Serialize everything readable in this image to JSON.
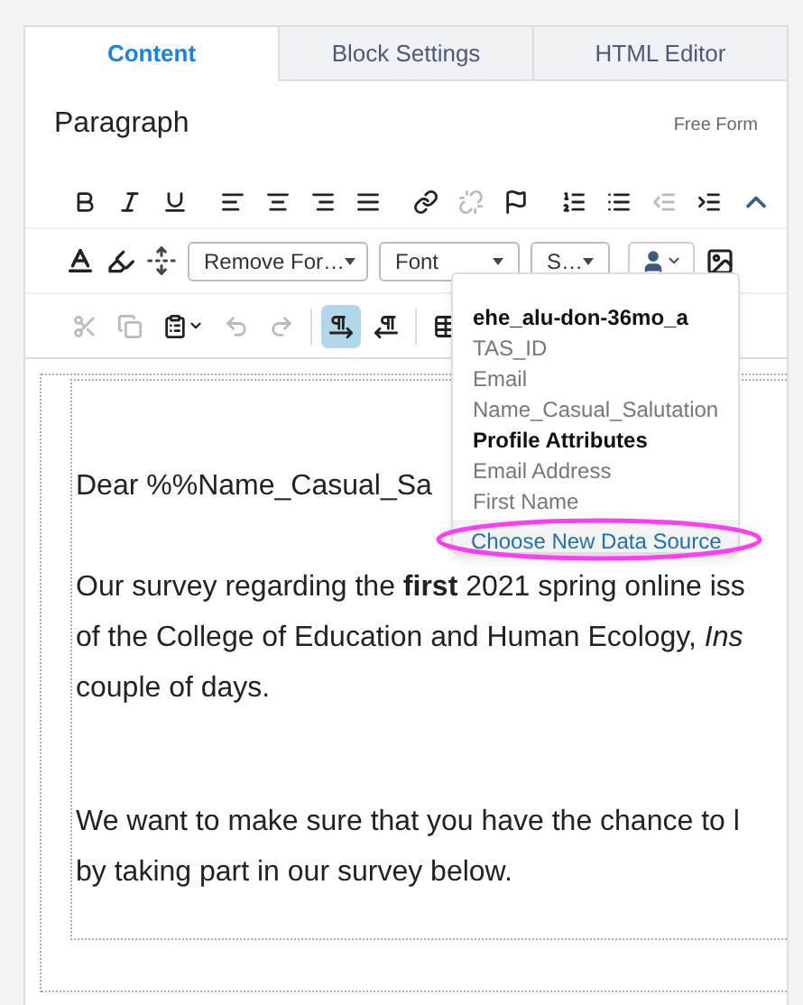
{
  "tabs": [
    {
      "label": "Content",
      "selected": true
    },
    {
      "label": "Block Settings",
      "selected": false
    },
    {
      "label": "HTML Editor",
      "selected": false
    }
  ],
  "format": {
    "label": "Paragraph",
    "mode": "Free Form"
  },
  "toolbar_1": [
    {
      "kind": "bold",
      "disabled": false
    },
    {
      "kind": "italic",
      "disabled": false
    },
    {
      "kind": "underline",
      "disabled": false
    },
    {
      "kind": "sep"
    },
    {
      "kind": "align-left",
      "disabled": false
    },
    {
      "kind": "align-center",
      "disabled": false
    },
    {
      "kind": "align-right",
      "disabled": false
    },
    {
      "kind": "justify",
      "disabled": false
    },
    {
      "kind": "sep"
    },
    {
      "kind": "link",
      "disabled": false
    },
    {
      "kind": "unlink",
      "disabled": true
    },
    {
      "kind": "flag",
      "disabled": false
    },
    {
      "kind": "sep"
    },
    {
      "kind": "ordered-list",
      "disabled": false
    },
    {
      "kind": "bullet-list",
      "disabled": false
    },
    {
      "kind": "outdent",
      "disabled": true
    },
    {
      "kind": "indent",
      "disabled": false
    }
  ],
  "toolbar_2": {
    "remove_format": "Remove For…",
    "font": "Font",
    "size": "S…"
  },
  "toolbar_3": [
    {
      "kind": "cut",
      "disabled": true,
      "selected": false
    },
    {
      "kind": "copy",
      "disabled": true,
      "selected": false
    },
    {
      "kind": "paste",
      "disabled": false,
      "selected": false
    },
    {
      "kind": "undo",
      "disabled": true,
      "selected": false
    },
    {
      "kind": "redo",
      "disabled": true,
      "selected": false
    },
    {
      "kind": "sep"
    },
    {
      "kind": "ltr",
      "disabled": false,
      "selected": true
    },
    {
      "kind": "rtl",
      "disabled": false,
      "selected": false
    },
    {
      "kind": "sep"
    },
    {
      "kind": "table",
      "disabled": false,
      "selected": false
    }
  ],
  "body": {
    "greeting": "Dear %%Name_Casual_Sa",
    "paragraph_1": [
      "Our survey regarding the **first** 2021 spring online iss",
      "of the College of Education and Human Ecology, *Ins*",
      "couple of days."
    ],
    "paragraph_2": [
      "We want to make sure that you have the chance to l",
      "by taking part in our survey below."
    ]
  },
  "dropdown": {
    "items": [
      {
        "kind": "group",
        "text": "ehe_alu-don-36mo_a"
      },
      {
        "kind": "field",
        "text": "TAS_ID"
      },
      {
        "kind": "field",
        "text": "Email"
      },
      {
        "kind": "field",
        "text": "Name_Casual_Salutation"
      },
      {
        "kind": "group",
        "text": "Profile Attributes"
      },
      {
        "kind": "field",
        "text": "Email Address"
      },
      {
        "kind": "field",
        "text": "First Name"
      }
    ],
    "footer_link": "Choose New Data Source"
  }
}
